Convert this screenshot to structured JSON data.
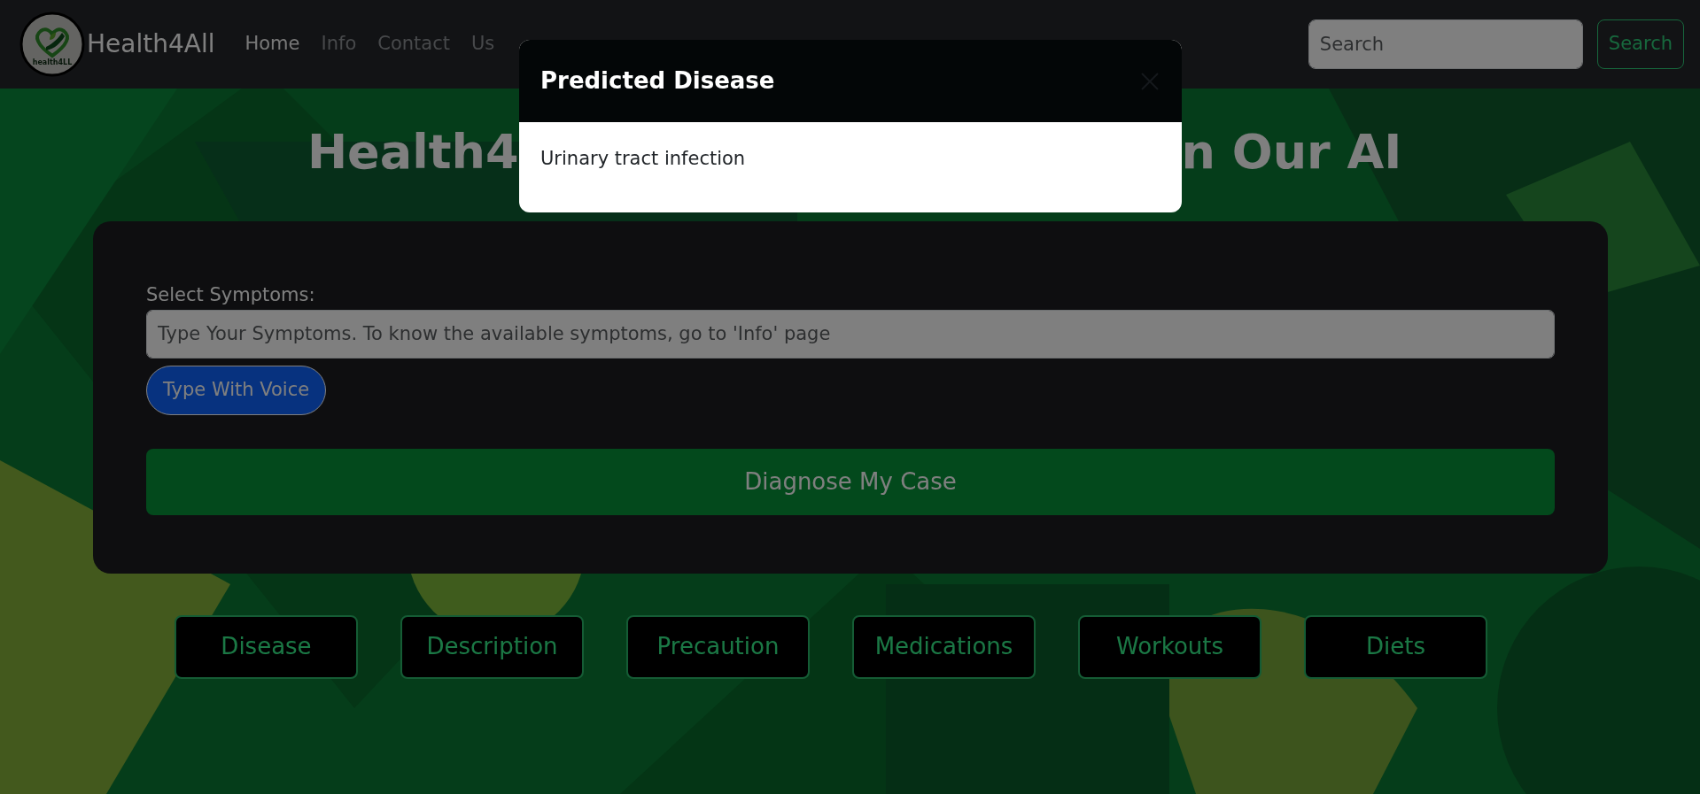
{
  "navbar": {
    "logo_text": "health4LL",
    "brand": "Health4All",
    "links": [
      {
        "label": "Home",
        "selected": true
      },
      {
        "label": "Info",
        "selected": false
      },
      {
        "label": "Contact",
        "selected": false
      },
      {
        "label": "Us",
        "selected": false
      }
    ],
    "search": {
      "placeholder": "Search",
      "button": "Search"
    }
  },
  "hero": {
    "title_parts": [
      "Health4",
      "n Our AI"
    ]
  },
  "form": {
    "label": "Select Symptoms:",
    "placeholder": "Type Your Symptoms. To know the available symptoms, go to 'Info' page",
    "voice_button": "Type With Voice",
    "submit_button": "Diagnose My Case"
  },
  "result_buttons": [
    "Disease",
    "Description",
    "Precaution",
    "Medications",
    "Workouts",
    "Diets"
  ],
  "modal": {
    "title": "Predicted Disease",
    "body": "Urinary tract infection"
  }
}
